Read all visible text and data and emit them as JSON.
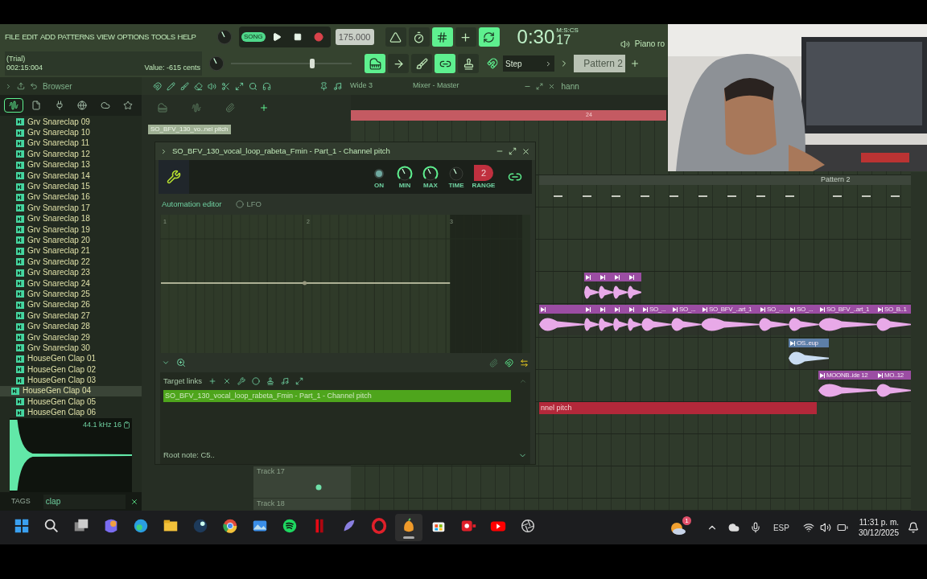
{
  "menu": [
    {
      "label": "FILE"
    },
    {
      "label": "EDIT"
    },
    {
      "label": "ADD"
    },
    {
      "label": "PATTERNS"
    },
    {
      "label": "VIEW"
    },
    {
      "label": "OPTIONS"
    },
    {
      "label": "TOOLS"
    },
    {
      "label": "HELP"
    }
  ],
  "transport": {
    "mode": "SONG",
    "song_mode": true,
    "recording": false,
    "tempo": "175.000",
    "time": "0:30",
    "time_sub": "17",
    "time_units": "M:S:CS"
  },
  "record_toggles": [
    {
      "kind": "metronome",
      "on": false
    },
    {
      "kind": "wait",
      "on": false
    },
    {
      "kind": "countdown",
      "on": true
    },
    {
      "kind": "step",
      "on": false
    },
    {
      "kind": "loop",
      "on": true
    }
  ],
  "hint": {
    "title": "(Trial)",
    "position": "002:15:004",
    "value": "Value: -615 cents"
  },
  "master_pitch": {
    "level": 0.68
  },
  "tool_toggles": [
    {
      "kind": "piano",
      "on": true
    },
    {
      "kind": "arrow",
      "on": false
    },
    {
      "kind": "brush",
      "on": false
    },
    {
      "kind": "link",
      "on": true
    },
    {
      "kind": "stamp",
      "on": false
    }
  ],
  "snap": "Step",
  "pattern": "Pattern 2",
  "piano_roll": "Piano ro",
  "toolbar": {
    "preset": "Wide 3",
    "mixer": "Mixer - Master",
    "user": "hann"
  },
  "browser": {
    "title": "Browser",
    "tabs": [
      {
        "kind": "all",
        "selected": true
      },
      {
        "kind": "files",
        "selected": false
      },
      {
        "kind": "plugins",
        "selected": false
      },
      {
        "kind": "online",
        "selected": false
      },
      {
        "kind": "cloud",
        "selected": false
      },
      {
        "kind": "favorites",
        "selected": false
      }
    ],
    "items": [
      {
        "name": "Grv Snareclap 09",
        "selected": false
      },
      {
        "name": "Grv Snareclap 10",
        "selected": false
      },
      {
        "name": "Grv Snareclap 11",
        "selected": false
      },
      {
        "name": "Grv Snareclap 12",
        "selected": false
      },
      {
        "name": "Grv Snareclap 13",
        "selected": false
      },
      {
        "name": "Grv Snareclap 14",
        "selected": false
      },
      {
        "name": "Grv Snareclap 15",
        "selected": false
      },
      {
        "name": "Grv Snareclap 16",
        "selected": false
      },
      {
        "name": "Grv Snareclap 17",
        "selected": false
      },
      {
        "name": "Grv Snareclap 18",
        "selected": false
      },
      {
        "name": "Grv Snareclap 19",
        "selected": false
      },
      {
        "name": "Grv Snareclap 20",
        "selected": false
      },
      {
        "name": "Grv Snareclap 21",
        "selected": false
      },
      {
        "name": "Grv Snareclap 22",
        "selected": false
      },
      {
        "name": "Grv Snareclap 23",
        "selected": false
      },
      {
        "name": "Grv Snareclap 24",
        "selected": false
      },
      {
        "name": "Grv Snareclap 25",
        "selected": false
      },
      {
        "name": "Grv Snareclap 26",
        "selected": false
      },
      {
        "name": "Grv Snareclap 27",
        "selected": false
      },
      {
        "name": "Grv Snareclap 28",
        "selected": false
      },
      {
        "name": "Grv Snareclap 29",
        "selected": false
      },
      {
        "name": "Grv Snareclap 30",
        "selected": false
      },
      {
        "name": "HouseGen Clap 01",
        "selected": false
      },
      {
        "name": "HouseGen Clap 02",
        "selected": false
      },
      {
        "name": "HouseGen Clap 03",
        "selected": false
      },
      {
        "name": "HouseGen Clap 04",
        "selected": true
      },
      {
        "name": "HouseGen Clap 05",
        "selected": false
      },
      {
        "name": "HouseGen Clap 06",
        "selected": false
      }
    ],
    "sample_info": "44.1 kHz 16",
    "tags_label": "TAGS",
    "search": "clap"
  },
  "channel_label": "SO_BFV_130_vo..nel pitch",
  "automation": {
    "title": "SO_BFV_130_vocal_loop_rabeta_Fmin - Part_1 - Channel pitch",
    "knobs": [
      {
        "kind": "led",
        "label": "ON"
      },
      {
        "kind": "arc",
        "label": "MIN"
      },
      {
        "kind": "arc",
        "label": "MAX"
      },
      {
        "kind": "plain",
        "label": "TIME"
      }
    ],
    "range": {
      "label": "RANGE",
      "value": "2"
    },
    "tabs": [
      {
        "label": "Automation editor",
        "selected": true
      },
      {
        "label": "LFO",
        "selected": false
      }
    ],
    "ruler": [
      "1",
      "2",
      "3"
    ],
    "target_links_label": "Target links",
    "targets": [
      {
        "label": "SO_BFV_130_vocal_loop_rabeta_Fmin - Part_1 - Channel pitch",
        "selected": true
      }
    ],
    "root_note": "Root note: C5.."
  },
  "playlist": {
    "marker": "24",
    "tracks": [
      "Track 17",
      "Track 18"
    ],
    "lanes": [
      {
        "kind": "empty"
      },
      {
        "clips": [
          {
            "kind": "pattern"
          },
          {
            "kind": "pattern",
            "label": "Pattern 2"
          }
        ]
      },
      {
        "kind": "empty"
      },
      {
        "kind": "empty"
      },
      {
        "clips": [
          {
            "kind": "audio"
          },
          {
            "kind": "audio"
          },
          {
            "kind": "audio"
          },
          {
            "kind": "audio"
          }
        ]
      },
      {
        "clips": [
          {
            "kind": "audio"
          },
          {
            "kind": "audio"
          },
          {
            "kind": "audio"
          },
          {
            "kind": "audio"
          },
          {
            "kind": "audio"
          },
          {
            "kind": "audio",
            "label": "SO_..."
          },
          {
            "kind": "audio",
            "label": "SO_..."
          },
          {
            "kind": "audio",
            "label": "SO_BFV_..art_1"
          },
          {
            "kind": "audio",
            "label": "SO_..."
          },
          {
            "kind": "audio",
            "label": "SO_..."
          },
          {
            "kind": "audio",
            "label": "SO_BFV_..art_1"
          },
          {
            "kind": "audio",
            "label": "SO_B..1"
          }
        ]
      },
      {
        "clips": [
          {
            "kind": "sample",
            "label": "OS..eup"
          }
        ]
      },
      {
        "clips": [
          {
            "kind": "audio",
            "label": "MOONB..ide 12"
          },
          {
            "kind": "audio",
            "label": "MO..12"
          }
        ]
      },
      {
        "clips": [
          {
            "kind": "automation",
            "label": "nnel pitch"
          }
        ]
      },
      {
        "kind": "empty"
      },
      {
        "kind": "empty"
      },
      {
        "kind": "empty"
      }
    ]
  },
  "taskbar": {
    "apps": [
      {
        "kind": "start",
        "selected": false
      },
      {
        "kind": "search",
        "selected": false
      },
      {
        "kind": "taskview",
        "selected": false
      },
      {
        "kind": "assistant",
        "selected": false
      },
      {
        "kind": "edge",
        "selected": false
      },
      {
        "kind": "folder",
        "selected": false
      },
      {
        "kind": "game",
        "selected": false
      },
      {
        "kind": "chrome",
        "selected": false
      },
      {
        "kind": "photos",
        "selected": false
      },
      {
        "kind": "music",
        "selected": false
      },
      {
        "kind": "video",
        "selected": false
      },
      {
        "kind": "feather",
        "selected": false
      },
      {
        "kind": "opera",
        "selected": false
      },
      {
        "kind": "fruit",
        "selected": true
      },
      {
        "kind": "store",
        "selected": false
      },
      {
        "kind": "recorder",
        "selected": false
      },
      {
        "kind": "youtube",
        "selected": false
      },
      {
        "kind": "aperture",
        "selected": false
      }
    ],
    "weather_badge": "1",
    "language": "ESP",
    "time": "11:31 p. m.",
    "date": "30/12/2025"
  }
}
